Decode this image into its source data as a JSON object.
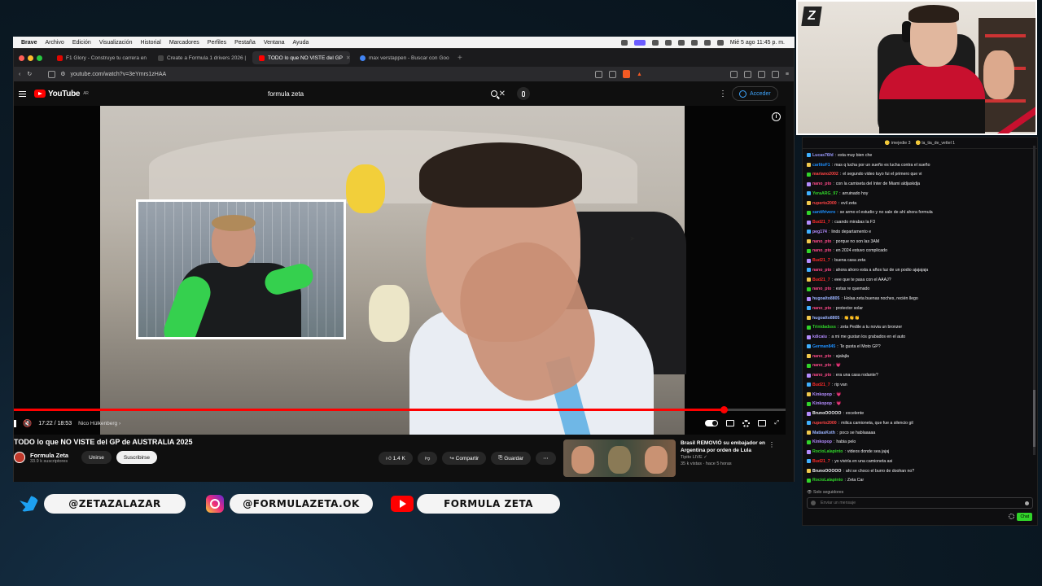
{
  "menubar": {
    "items": [
      "Brave",
      "Archivo",
      "Edición",
      "Visualización",
      "Historial",
      "Marcadores",
      "Perfiles",
      "Pestaña",
      "Ventana",
      "Ayuda"
    ],
    "datetime": "Mié 5 ago  11:45 p. m."
  },
  "browser": {
    "tabs": [
      {
        "label": "F1 Glory - Construye tu carrera en",
        "color": "#e10600"
      },
      {
        "label": "Create a Formula 1 drivers 2026 | ",
        "color": "#444444"
      },
      {
        "label": "TODO lo que NO VISTE del GP",
        "color": "#ff0000"
      },
      {
        "label": "max verstappen - Buscar con Goo",
        "color": "#4285f4"
      }
    ],
    "url": "youtube.com/watch?v=3eYmrs1zHAA"
  },
  "youtube": {
    "logo": "YouTube",
    "region": "AR",
    "search_query": "formula zeta",
    "signin": "Acceder"
  },
  "player": {
    "time": "17:22 / 18:53",
    "chapter": "Nico Hülkenberg",
    "progress": 0.92
  },
  "video": {
    "title": "TODO lo que NO VISTE del GP de AUSTRALIA 2025",
    "channel": "Formula Zeta",
    "subscribers": "33.9 k suscriptores",
    "join": "Unirse",
    "subscribe": "Suscribirse",
    "likes": "1.4 K",
    "share": "Compartir",
    "save": "Guardar"
  },
  "recommended": {
    "title": "Brasil REMOVIÓ su embajador en Argentina por orden de Lula",
    "channel": "Tipito LIVE",
    "meta": "35 k vistas · hace 5 horas"
  },
  "chat": {
    "pinned": [
      "imejedie",
      "la_tia_de_vettel"
    ],
    "messages": [
      {
        "user": "Lucas76fd",
        "color": "#9b9bff",
        "text": "esta muy bien che"
      },
      {
        "user": "carlitoF1",
        "color": "#1e90ff",
        "text": "mas q lucha por un sueño es lucha contra el sueño"
      },
      {
        "user": "mariano2002",
        "color": "#ff4444",
        "text": "el segundo video tuyo fui el primero que vi"
      },
      {
        "user": "nano_pto",
        "color": "#ff4a8a",
        "text": "con la camiseta del Inter de Miami aldjaskdja"
      },
      {
        "user": "YeraARG_97",
        "color": "#31d42a",
        "text": "arruinado hoy"
      },
      {
        "user": "ruperto2000",
        "color": "#ff4444",
        "text": "evil zeta"
      },
      {
        "user": "santifrivero",
        "color": "#1e90ff",
        "text": "se armo el estudio y no sale de ahí ahora formula"
      },
      {
        "user": "Bud21_7",
        "color": "#ff2a2a",
        "text": "cuando mirabas la F3"
      },
      {
        "user": "peg174",
        "color": "#b48cff",
        "text": "lindo departamento e"
      },
      {
        "user": "nano_pto",
        "color": "#ff4a8a",
        "text": "porque no son las 3AM"
      },
      {
        "user": "nano_pto",
        "color": "#ff4a8a",
        "text": "en 2024 estuvo complicado"
      },
      {
        "user": "Bud21_7",
        "color": "#ff2a2a",
        "text": "buena casa zeta"
      },
      {
        "user": "nano_pto",
        "color": "#ff4a8a",
        "text": "ahora ahoro esta a años luz de un podio ajajajaja"
      },
      {
        "user": "Bud21_7",
        "color": "#ff2a2a",
        "text": "eee que te pasa con el AAAJ?"
      },
      {
        "user": "nano_pto",
        "color": "#ff4a8a",
        "text": "estas re quemado"
      },
      {
        "user": "hugoalto8805",
        "color": "#9bb4ff",
        "text": "Holaa zeta buenas noches, recién llego"
      },
      {
        "user": "nano_pto",
        "color": "#ff4a8a",
        "text": "protector solar"
      },
      {
        "user": "hugoalto8805",
        "color": "#9bb4ff",
        "text": "👏👏👏"
      },
      {
        "user": "Trinidadsss",
        "color": "#31d42a",
        "text": "zeta Pedile a tu novia un bronzer"
      },
      {
        "user": "kdicaiu",
        "color": "#b48cff",
        "text": "a mi me gustan los grabados en el auto"
      },
      {
        "user": "German845",
        "color": "#1e90ff",
        "text": "Te gusta el Moto GP?"
      },
      {
        "user": "nano_pto",
        "color": "#ff4a8a",
        "text": "ajalajla"
      },
      {
        "user": "nano_pto",
        "color": "#ff4a8a",
        "text": "💗"
      },
      {
        "user": "nano_pto",
        "color": "#ff4a8a",
        "text": "era una casa rodante?"
      },
      {
        "user": "Bud21_7",
        "color": "#ff2a2a",
        "text": "rip van"
      },
      {
        "user": "Kinkopop",
        "color": "#b48cff",
        "text": "💗"
      },
      {
        "user": "Kinkopop",
        "color": "#b48cff",
        "text": "💗"
      },
      {
        "user": "BrunoOOOOO",
        "color": "#efeff1",
        "text": "excelente"
      },
      {
        "user": "ruperto2000",
        "color": "#ff4444",
        "text": "milica camioneta, que fue a silencio gil"
      },
      {
        "user": "MatiasKoth",
        "color": "#9bb4ff",
        "text": "poco se hablaaaaa"
      },
      {
        "user": "Kinkopop",
        "color": "#b48cff",
        "text": "habia pelo"
      },
      {
        "user": "RocioLalapinto",
        "color": "#31d42a",
        "text": "videos donde sea jajaj"
      },
      {
        "user": "Bud21_7",
        "color": "#ff2a2a",
        "text": "yo viviría en una camioneta asi"
      },
      {
        "user": "BrunoOOOOO",
        "color": "#efeff1",
        "text": "ahi se choco el burro de doohan no?"
      },
      {
        "user": "RocioLalapinto",
        "color": "#31d42a",
        "text": "Zeta Car"
      }
    ],
    "followers_only": "Solo seguidores",
    "input_placeholder": "Enviar un mensaje",
    "send": "Chat"
  },
  "socials": {
    "twitter": "@ZETAZALAZAR",
    "instagram": "@FORMULAZETA.OK",
    "youtube": "FORMULA ZETA"
  }
}
